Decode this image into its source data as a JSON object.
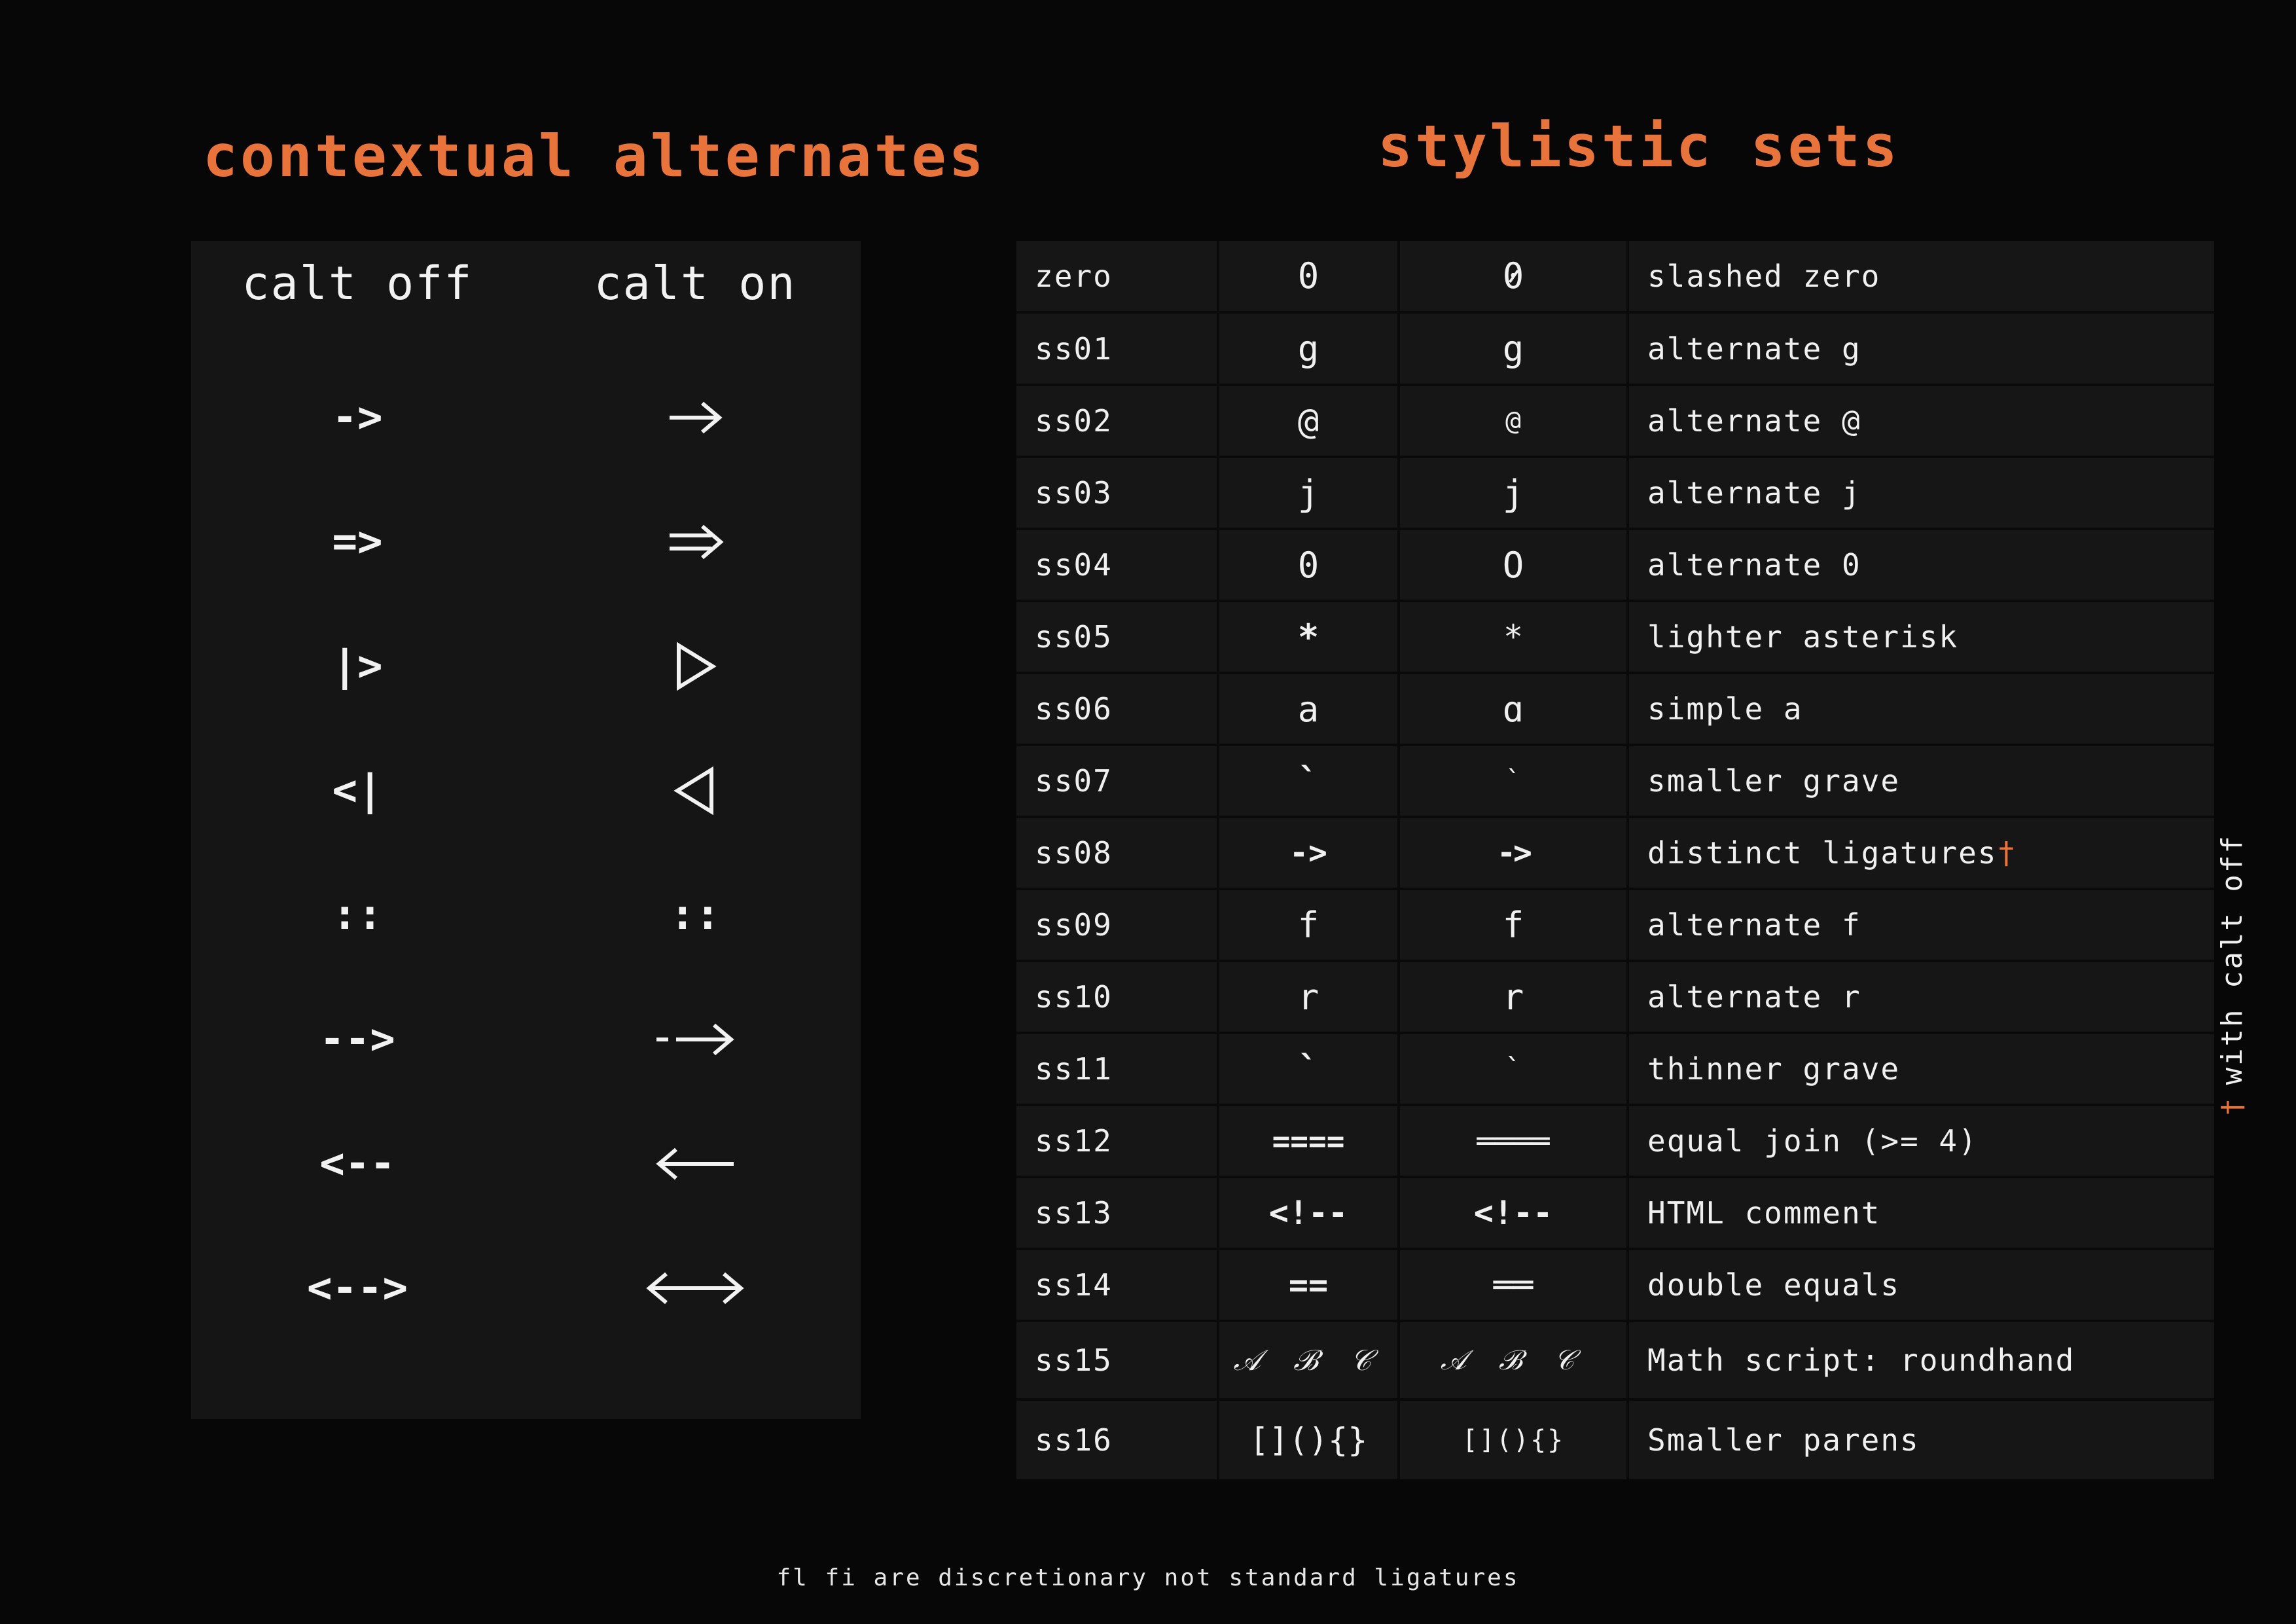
{
  "calt": {
    "title": "contextual alternates",
    "header_off": "calt off",
    "header_on": "calt on",
    "rows": [
      {
        "off": "->",
        "on_icon": "single-arrow-right-icon"
      },
      {
        "off": "=>",
        "on_icon": "double-arrow-right-icon"
      },
      {
        "off": "|>",
        "on_icon": "triangle-right-icon"
      },
      {
        "off": "<|",
        "on_icon": "triangle-left-icon"
      },
      {
        "off": "::",
        "on": "::"
      },
      {
        "off": "-->",
        "on_icon": "long-arrow-right-icon"
      },
      {
        "off": "<--",
        "on_icon": "long-arrow-left-icon"
      },
      {
        "off": "<-->",
        "on_icon": "long-double-headed-arrow-icon"
      }
    ]
  },
  "ss": {
    "title": "stylistic sets",
    "rows": [
      {
        "tag": "zero",
        "off": "0",
        "on": "0",
        "desc": "slashed zero"
      },
      {
        "tag": "ss01",
        "off": "g",
        "on": "g",
        "desc": "alternate g"
      },
      {
        "tag": "ss02",
        "off": "@",
        "on": "@",
        "desc": "alternate @"
      },
      {
        "tag": "ss03",
        "off": "j",
        "on": "j",
        "desc": "alternate j"
      },
      {
        "tag": "ss04",
        "off": "0",
        "on": "O",
        "desc": "alternate 0"
      },
      {
        "tag": "ss05",
        "off": "*",
        "on": "*",
        "desc": "lighter asterisk"
      },
      {
        "tag": "ss06",
        "off": "a",
        "on": "ɑ",
        "desc": "simple a"
      },
      {
        "tag": "ss07",
        "off": "`",
        "on": "`",
        "desc": "smaller grave"
      },
      {
        "tag": "ss08",
        "off": "->",
        "on": "->",
        "desc": "distinct ligatures",
        "desc_mark": "†"
      },
      {
        "tag": "ss09",
        "off": "f",
        "on": "f",
        "desc": "alternate f"
      },
      {
        "tag": "ss10",
        "off": "r",
        "on": "r",
        "desc": "alternate r"
      },
      {
        "tag": "ss11",
        "off": "`",
        "on": "`",
        "desc": "thinner grave"
      },
      {
        "tag": "ss12",
        "off": "====",
        "on": "════",
        "desc": "equal join (>= 4)"
      },
      {
        "tag": "ss13",
        "off": "<!--",
        "on": "<!--",
        "desc": "HTML comment"
      },
      {
        "tag": "ss14",
        "off": "==",
        "on": "══",
        "desc": "double equals"
      },
      {
        "tag": "ss15",
        "off": "𝒜 ℬ 𝒞",
        "on": "𝒜 ℬ 𝒞",
        "desc": "Math script: roundhand"
      },
      {
        "tag": "ss16",
        "off": "[](){}",
        "on": "[](){}",
        "desc": "Smaller parens"
      }
    ]
  },
  "side_note": {
    "mark": "†",
    "text": "with calt off"
  },
  "footer": "fl fi are discretionary not standard ligatures",
  "colors": {
    "accent": "#e8743b",
    "background": "#070707",
    "panel": "#151515",
    "text": "#f2f2f2"
  }
}
